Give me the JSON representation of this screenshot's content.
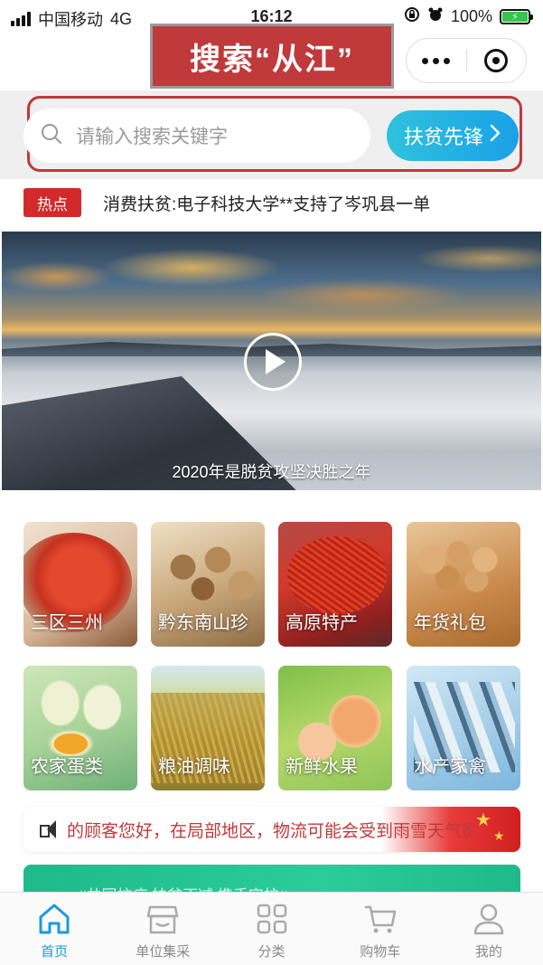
{
  "status_bar": {
    "carrier": "中国移动",
    "network": "4G",
    "time": "16:12",
    "battery": "100%"
  },
  "header": {
    "overlay_title": "搜索“从江”"
  },
  "search": {
    "placeholder": "请输入搜索关键字",
    "button_label": "扶贫先锋"
  },
  "hot": {
    "badge": "热点",
    "headline": "消费扶贫:电子科技大学**支持了岑巩县一单"
  },
  "video": {
    "caption": "2020年是脱贫攻坚决胜之年"
  },
  "categories": [
    {
      "label": "三区三州",
      "icon": "goji-berry-image"
    },
    {
      "label": "黔东南山珍",
      "icon": "mushroom-image"
    },
    {
      "label": "高原特产",
      "icon": "saffron-image"
    },
    {
      "label": "年货礼包",
      "icon": "walnut-image"
    },
    {
      "label": "农家蛋类",
      "icon": "egg-image"
    },
    {
      "label": "粮油调味",
      "icon": "rice-image"
    },
    {
      "label": "新鲜水果",
      "icon": "peach-image"
    },
    {
      "label": "水产家禽",
      "icon": "fish-image"
    }
  ],
  "notice": {
    "text": "的顾客您好，在局部地区，物流可能会受到雨雪天气影"
  },
  "promo": {
    "text": "#共同抗疫 扶贫不减 携手守护#"
  },
  "tabs": [
    {
      "label": "首页",
      "icon": "home-icon",
      "active": true
    },
    {
      "label": "单位集采",
      "icon": "store-icon",
      "active": false
    },
    {
      "label": "分类",
      "icon": "grid-icon",
      "active": false
    },
    {
      "label": "购物车",
      "icon": "cart-icon",
      "active": false
    },
    {
      "label": "我的",
      "icon": "user-icon",
      "active": false
    }
  ],
  "colors": {
    "accent": "#1a9bdd",
    "highlight_red": "#c0393b"
  }
}
